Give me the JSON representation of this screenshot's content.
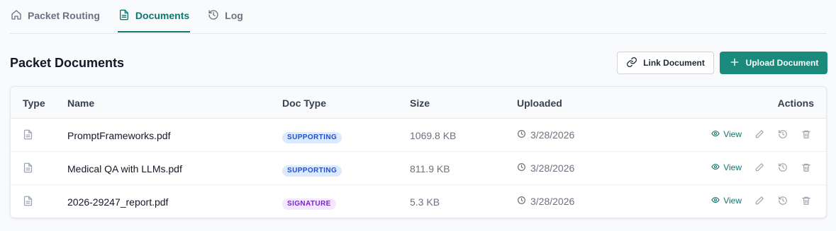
{
  "tabs": [
    {
      "label": "Packet Routing",
      "icon": "home-icon",
      "active": false
    },
    {
      "label": "Documents",
      "icon": "document-icon",
      "active": true
    },
    {
      "label": "Log",
      "icon": "history-icon",
      "active": false
    }
  ],
  "section": {
    "title": "Packet Documents",
    "link_button": "Link Document",
    "upload_button": "Upload Document"
  },
  "table": {
    "headers": {
      "type": "Type",
      "name": "Name",
      "doc_type": "Doc Type",
      "size": "Size",
      "uploaded": "Uploaded",
      "actions": "Actions"
    },
    "view_label": "View",
    "rows": [
      {
        "name": "PromptFrameworks.pdf",
        "doc_type": "SUPPORTING",
        "size": "1069.8 KB",
        "uploaded": "3/28/2026"
      },
      {
        "name": "Medical QA with LLMs.pdf",
        "doc_type": "SUPPORTING",
        "size": "811.9 KB",
        "uploaded": "3/28/2026"
      },
      {
        "name": "2026-29247_report.pdf",
        "doc_type": "SIGNATURE",
        "size": "5.3 KB",
        "uploaded": "3/28/2026"
      }
    ]
  },
  "colors": {
    "accent": "#0f766e",
    "primary_button": "#1a8a7c",
    "badge_supporting_bg": "#dbeafe",
    "badge_supporting_text": "#1d4ed8",
    "badge_signature_bg": "#f3e8ff",
    "badge_signature_text": "#7e22ce"
  }
}
